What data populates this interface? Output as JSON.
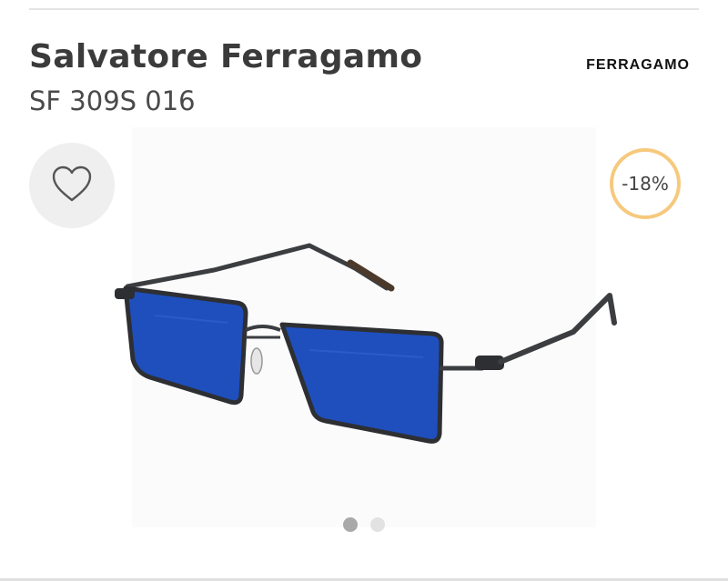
{
  "product": {
    "brand": "Salvatore Ferragamo",
    "model": "SF 309S 016",
    "brand_logo_text": "FERRAGAMO",
    "discount": "-18%"
  },
  "favorite": {
    "icon": "heart-outline-icon"
  },
  "carousel": {
    "total": 2,
    "active_index": 0
  },
  "colors": {
    "lens": "#1f4fbd",
    "frame": "#3b3d40",
    "badge_ring": "#f6c97d",
    "fav_bg": "#efefef"
  }
}
